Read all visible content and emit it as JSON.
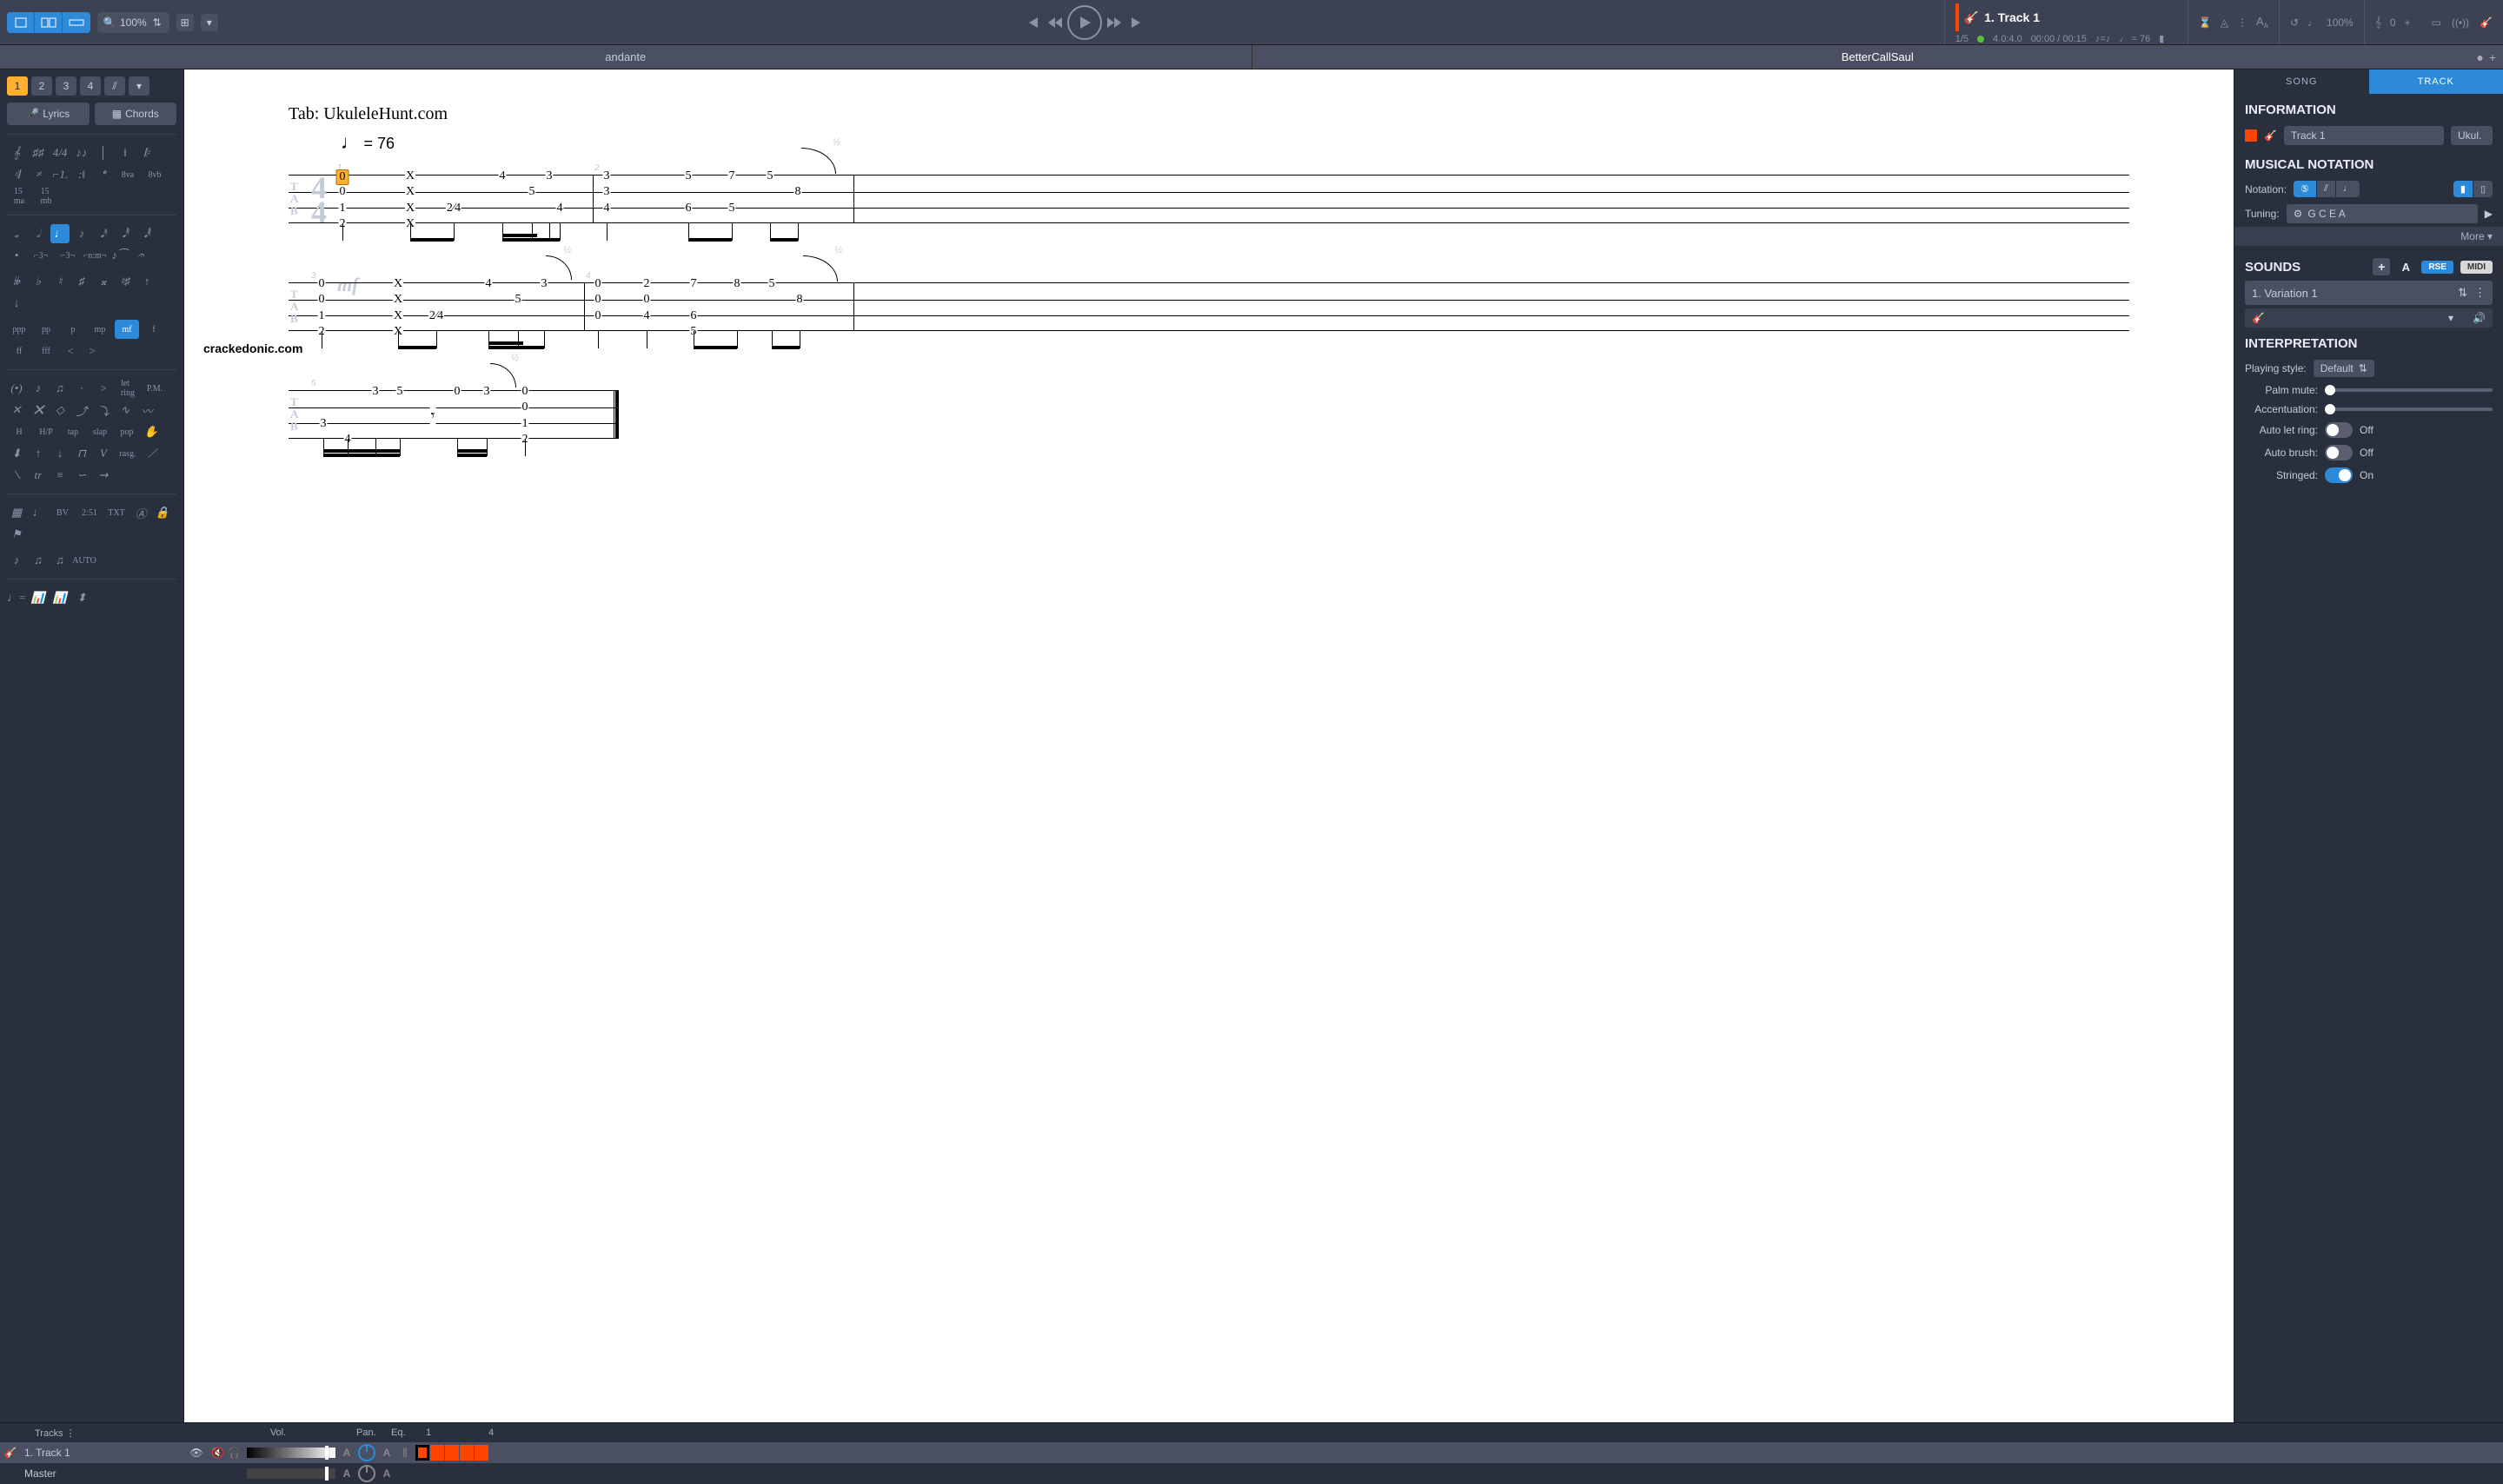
{
  "topbar": {
    "zoom": "100%",
    "track_label": "1. Track 1",
    "bar_pos": "1/5",
    "beat_pos": "4.0:4.0",
    "time": "00:00 / 00:15",
    "tempo_txt": "= 76",
    "speed_trainer": "100%",
    "transpose": "0"
  },
  "subheader": {
    "left": "andante",
    "right": "BetterCallSaul"
  },
  "palette": {
    "voices": [
      "1",
      "2",
      "3",
      "4"
    ],
    "active_voice": 0,
    "lyrics_label": "Lyrics",
    "chords_label": "Chords",
    "dynamics": [
      "ppp",
      "pp",
      "p",
      "mp",
      "mf",
      "f",
      "ff",
      "fff"
    ]
  },
  "score": {
    "title_line": "Tab: UkuleleHunt.com",
    "tempo": "= 76",
    "mf": "mf",
    "watermark": "crackedonic.com",
    "chart_data": {
      "type": "table",
      "note": "Ukulele tablature, 4-string (G C E A), 4/4 time. Rows are strings top→bottom = A,E,C,G.",
      "time_signature": "4/4",
      "tempo_bpm": 76,
      "dynamic": "mf",
      "selected": {
        "measure": 1,
        "beat": 1,
        "string": "A",
        "fret": 0
      },
      "measures": [
        {
          "n": 1,
          "events": [
            {
              "frets": {
                "A": 0,
                "E": 0,
                "C": 1,
                "G": 2
              }
            },
            {
              "frets": {
                "A": "X",
                "E": "X",
                "C": "X",
                "G": "X"
              }
            },
            {
              "frets": {
                "C": "2/4"
              }
            },
            {
              "frets": {
                "A": 4
              }
            },
            {
              "frets": {
                "E": 5
              }
            },
            {
              "frets": {
                "A": 3
              }
            },
            {
              "frets": {
                "E": 4
              }
            }
          ]
        },
        {
          "n": 2,
          "events": [
            {
              "frets": {
                "A": 3,
                "E": 3,
                "C": 4
              }
            },
            {
              "frets": {
                "A": 5,
                "C": 6
              }
            },
            {
              "frets": {
                "A": 7,
                "C": 5
              }
            },
            {
              "frets": {
                "A": 5
              }
            },
            {
              "frets": {
                "E": 8
              },
              "bend": "1/2"
            }
          ]
        },
        {
          "n": 3,
          "events": [
            {
              "frets": {
                "A": 0,
                "E": 0,
                "C": 1,
                "G": 2
              }
            },
            {
              "frets": {
                "A": "X",
                "E": "X",
                "C": "X",
                "G": "X"
              }
            },
            {
              "frets": {
                "C": "2/4"
              }
            },
            {
              "frets": {
                "A": 4
              }
            },
            {
              "frets": {
                "E": 5
              }
            },
            {
              "frets": {
                "A": 3
              },
              "bend": "1/2"
            },
            {
              "frets": {
                "A": 0,
                "E": 0,
                "C": 0
              }
            }
          ]
        },
        {
          "n": 4,
          "events": [
            {
              "frets": {
                "A": 2,
                "E": 0,
                "C": 4
              }
            },
            {
              "frets": {
                "A": 7,
                "C": 6,
                "G": 5
              }
            },
            {
              "frets": {
                "A": 8
              }
            },
            {
              "frets": {
                "A": 5
              }
            },
            {
              "frets": {
                "E": 8
              },
              "bend": "1/2"
            }
          ]
        },
        {
          "n": 5,
          "events": [
            {
              "frets": {
                "C": 3,
                "G": 4
              }
            },
            {
              "frets": {
                "A": 3
              }
            },
            {
              "frets": {
                "A": 5
              }
            },
            {
              "rest": "eighth"
            },
            {
              "frets": {
                "A": 0
              }
            },
            {
              "frets": {
                "A": 3
              }
            },
            {
              "frets": {
                "A": 0,
                "E": 0,
                "C": 1,
                "G": 2
              },
              "bend": "1/2"
            }
          ]
        }
      ]
    }
  },
  "right": {
    "tabs": [
      "SONG",
      "TRACK"
    ],
    "active_tab": 1,
    "info_h": "INFORMATION",
    "track_name": "Track 1",
    "track_short": "Ukul.",
    "notation_h": "MUSICAL NOTATION",
    "notation_label": "Notation:",
    "tuning_label": "Tuning:",
    "tuning": "G C E A",
    "more": "More ▾",
    "sounds_h": "SOUNDS",
    "rse": "RSE",
    "midi": "MIDI",
    "variation": "1. Variation 1",
    "interp_h": "INTERPRETATION",
    "playing_style_label": "Playing style:",
    "playing_style": "Default",
    "palm_mute": "Palm mute:",
    "accentuation": "Accentuation:",
    "auto_let_ring": {
      "label": "Auto let ring:",
      "state": "Off"
    },
    "auto_brush": {
      "label": "Auto brush:",
      "state": "Off"
    },
    "stringed": {
      "label": "Stringed:",
      "state": "On"
    }
  },
  "bottom": {
    "tracks_h": "Tracks",
    "vol_h": "Vol.",
    "pan_h": "Pan.",
    "eq_h": "Eq.",
    "track1": "1. Track 1",
    "master": "Master",
    "bar_numbers": [
      "1",
      "4"
    ]
  }
}
